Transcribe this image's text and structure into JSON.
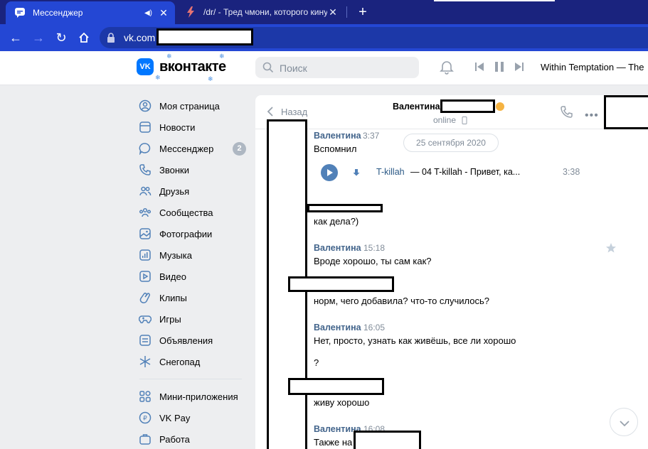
{
  "browser": {
    "tabs": [
      {
        "title": "Мессенджер",
        "close": "✕"
      },
      {
        "title": "/dr/ - Тред чмони, которого кинула",
        "close": "✕"
      }
    ],
    "new_tab": "+",
    "url": "vk.com"
  },
  "header": {
    "logo_text": "вконтакте",
    "logo_mark": "VK",
    "search_placeholder": "Поиск",
    "now_playing": "Within Temptation — The"
  },
  "menu": {
    "items": [
      {
        "label": "Моя страница",
        "icon": "user-icon"
      },
      {
        "label": "Новости",
        "icon": "news-icon"
      },
      {
        "label": "Мессенджер",
        "icon": "messenger-icon",
        "badge": "2"
      },
      {
        "label": "Звонки",
        "icon": "phone-icon"
      },
      {
        "label": "Друзья",
        "icon": "friends-icon"
      },
      {
        "label": "Сообщества",
        "icon": "communities-icon"
      },
      {
        "label": "Фотографии",
        "icon": "photos-icon"
      },
      {
        "label": "Музыка",
        "icon": "music-icon"
      },
      {
        "label": "Видео",
        "icon": "video-icon"
      },
      {
        "label": "Клипы",
        "icon": "clips-icon"
      },
      {
        "label": "Игры",
        "icon": "games-icon"
      },
      {
        "label": "Объявления",
        "icon": "ads-icon"
      },
      {
        "label": "Снегопад",
        "icon": "snowflake-icon"
      },
      {
        "label": "Мини-приложения",
        "icon": "mini-apps-icon"
      },
      {
        "label": "VK Pay",
        "icon": "vkpay-icon"
      },
      {
        "label": "Работа",
        "icon": "work-icon"
      }
    ]
  },
  "chat": {
    "back_label": "Назад",
    "peer_name": "Валентина",
    "status": "online",
    "date": "25 сентября 2020",
    "messages": [
      {
        "name": "Валентина",
        "time": "3:37",
        "text": "Вспомнил"
      },
      {
        "name": "",
        "time": "",
        "text": "как дела?)"
      },
      {
        "name": "Валентина",
        "time": "15:18",
        "text": "Вроде хорошо, ты сам как?"
      },
      {
        "name": "",
        "time": "",
        "text": "норм, чего добавила? что-то случилось?"
      },
      {
        "name": "Валентина",
        "time": "16:05",
        "text": "Нет, просто, узнать как живёшь, все ли хорошо"
      },
      {
        "name": "",
        "time": "",
        "text": "?"
      },
      {
        "name": "",
        "time": "",
        "text": "живу хорошо"
      },
      {
        "name": "Валентина",
        "time": "16:08",
        "text": "Также на"
      }
    ],
    "audio": {
      "artist": "T-killah",
      "dash": "—",
      "title": "04 T-killah - Привет, ка...",
      "duration": "3:38"
    },
    "more": "•••"
  },
  "colors": {
    "tabbar": "#1a237e",
    "toolbar": "#2447d4",
    "vk_blue": "#0077ff",
    "link": "#42648b"
  }
}
